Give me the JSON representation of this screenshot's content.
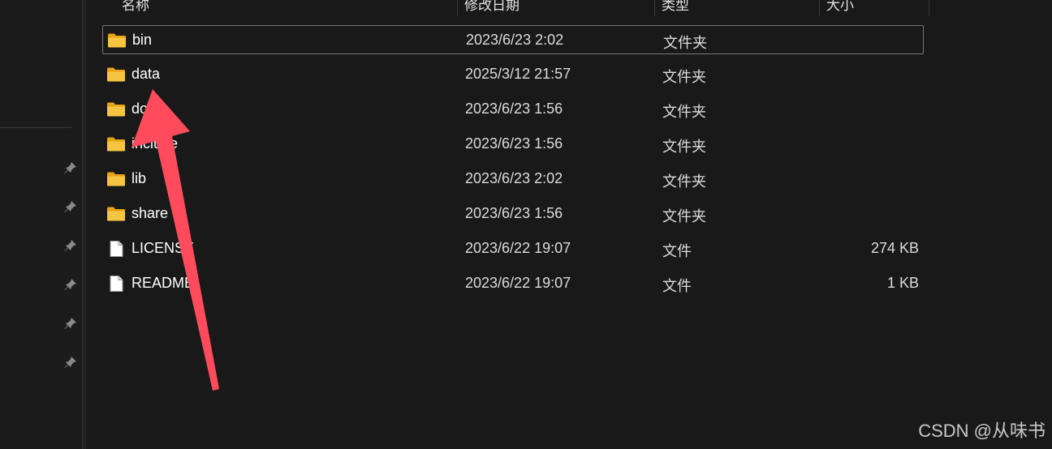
{
  "columns": {
    "name": "名称",
    "date": "修改日期",
    "type": "类型",
    "size": "大小"
  },
  "files": [
    {
      "name": "bin",
      "date": "2023/6/23 2:02",
      "type": "文件夹",
      "size": "",
      "icon": "folder-icon",
      "selected": true
    },
    {
      "name": "data",
      "date": "2025/3/12 21:57",
      "type": "文件夹",
      "size": "",
      "icon": "folder-icon"
    },
    {
      "name": "doc",
      "date": "2023/6/23 1:56",
      "type": "文件夹",
      "size": "",
      "icon": "folder-icon"
    },
    {
      "name": "include",
      "date": "2023/6/23 1:56",
      "type": "文件夹",
      "size": "",
      "icon": "folder-icon"
    },
    {
      "name": "lib",
      "date": "2023/6/23 2:02",
      "type": "文件夹",
      "size": "",
      "icon": "folder-icon"
    },
    {
      "name": "share",
      "date": "2023/6/23 1:56",
      "type": "文件夹",
      "size": "",
      "icon": "folder-icon"
    },
    {
      "name": "LICENSE",
      "date": "2023/6/22 19:07",
      "type": "文件",
      "size": "274 KB",
      "icon": "file-icon"
    },
    {
      "name": "README",
      "date": "2023/6/22 19:07",
      "type": "文件",
      "size": "1 KB",
      "icon": "file-icon"
    }
  ],
  "pinned_count": 6,
  "annotation": {
    "arrow_icon": "annotation-arrow",
    "arrow_color": "#ff4b5c",
    "target": "data"
  },
  "watermark": "CSDN @从味书",
  "colors": {
    "background": "#191919",
    "folder": "#f5c542",
    "selection_border": "#777777"
  }
}
